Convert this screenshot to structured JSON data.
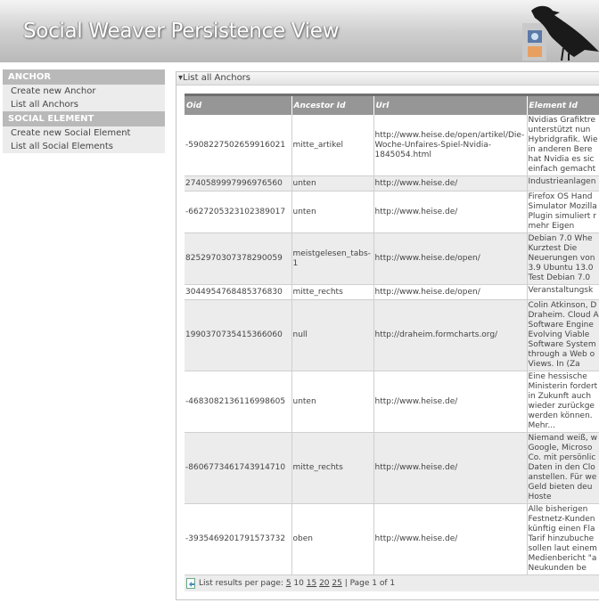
{
  "header": {
    "title": "Social Weaver Persistence View"
  },
  "sidebar": {
    "sections": [
      {
        "heading": "ANCHOR",
        "items": [
          "Create new Anchor",
          "List all Anchors"
        ]
      },
      {
        "heading": "SOCIAL ELEMENT",
        "items": [
          "Create new Social Element",
          "List all Social Elements"
        ]
      }
    ]
  },
  "panel": {
    "title": "List all Anchors",
    "columns": [
      "Oid",
      "Ancestor Id",
      "Url",
      "Element Id"
    ],
    "rows": [
      {
        "oid": "-5908227502659916021",
        "ancestor": "mitte_artikel",
        "url": "http://www.heise.de/open/artikel/Die-Woche-Unfaires-Spiel-Nvidia-1845054.html",
        "element": "Nvidias Grafiktre unterstützt nun Hybridgrafik. Wie in anderen Bere hat Nvidia es sic einfach gemacht"
      },
      {
        "oid": "2740589997996976560",
        "ancestor": "unten",
        "url": "http://www.heise.de/",
        "element": "Industrieanlagen"
      },
      {
        "oid": "-6627205323102389017",
        "ancestor": "unten",
        "url": "http://www.heise.de/",
        "element": "Firefox OS Hand Simulator Mozilla Plugin simuliert r mehr Eigen"
      },
      {
        "oid": "8252970307378290059",
        "ancestor": "meistgelesen_tabs-1",
        "url": "http://www.heise.de/open/",
        "element": "Debian 7.0 Whe Kurztest Die Neuerungen von 3.9 Ubuntu 13.0 Test Debian 7.0"
      },
      {
        "oid": "3044954768485376830",
        "ancestor": "mitte_rechts",
        "url": "http://www.heise.de/open/",
        "element": "Veranstaltungsk"
      },
      {
        "oid": "1990370735415366060",
        "ancestor": "null",
        "url": "http://draheim.formcharts.org/",
        "element": "Colin Atkinson, D Draheim. Cloud A Software Engine Evolving Viable Software System through a Web o Views. In (Za"
      },
      {
        "oid": "-4683082136116998605",
        "ancestor": "unten",
        "url": "http://www.heise.de/",
        "element": "Eine hessische Ministerin fordert in Zukunft auch wieder zurückge werden können. Mehr..."
      },
      {
        "oid": "-8606773461743914710",
        "ancestor": "mitte_rechts",
        "url": "http://www.heise.de/",
        "element": "Niemand weiß, w Google, Microso Co. mit persönlic Daten in den Clo anstellen. Für we Geld bieten deu Hoste"
      },
      {
        "oid": "-3935469201791573732",
        "ancestor": "oben",
        "url": "http://www.heise.de/",
        "element": "Alle bisherigen Festnetz-Kunden künftig einen Fla Tarif hinzubuche sollen laut einem Medienbericht \"a Neukunden be"
      }
    ],
    "footer": {
      "label": "List results per page:",
      "options": [
        "5",
        "10",
        "15",
        "20",
        "25"
      ],
      "current": "10",
      "page_info": "| Page 1 of 1"
    }
  }
}
